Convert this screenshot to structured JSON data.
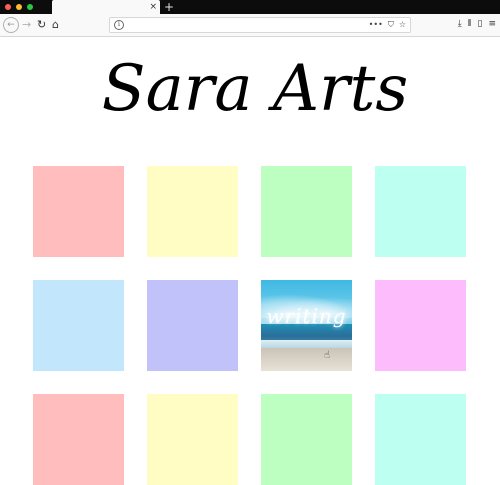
{
  "browser": {
    "traffic_lights": [
      {
        "name": "close",
        "color": "#ff5f57"
      },
      {
        "name": "minimize",
        "color": "#febc2e"
      },
      {
        "name": "maximize",
        "color": "#28c840"
      }
    ],
    "tab": {
      "title": "",
      "close_glyph": "×"
    },
    "new_tab_glyph": "+",
    "toolbar": {
      "back_glyph": "←",
      "forward_glyph": "→",
      "reload_glyph": "↻",
      "home_glyph": "⌂",
      "url": "",
      "info_glyph": "i",
      "url_actions": [
        {
          "name": "more-icon",
          "glyph": "•••"
        },
        {
          "name": "pocket-icon",
          "glyph": "⛉"
        },
        {
          "name": "bookmark-star-icon",
          "glyph": "☆"
        }
      ],
      "right_actions": [
        {
          "name": "downloads-icon",
          "glyph": "⤓"
        },
        {
          "name": "library-icon",
          "glyph": "⫴"
        },
        {
          "name": "sidebar-icon",
          "glyph": "▯"
        },
        {
          "name": "menu-icon",
          "glyph": "≡"
        }
      ]
    }
  },
  "page": {
    "title": "Sara Arts",
    "gallery": [
      {
        "kind": "swatch",
        "color": "#ffbdbd"
      },
      {
        "kind": "swatch",
        "color": "#fffcc4"
      },
      {
        "kind": "swatch",
        "color": "#bdffc0"
      },
      {
        "kind": "swatch",
        "color": "#bdfff0"
      },
      {
        "kind": "swatch",
        "color": "#c2e6fb"
      },
      {
        "kind": "swatch",
        "color": "#c2c2fb"
      },
      {
        "kind": "image",
        "label": "writing",
        "color": "#5bbfe0"
      },
      {
        "kind": "swatch",
        "color": "#fdbdfd"
      },
      {
        "kind": "swatch",
        "color": "#ffbdbd"
      },
      {
        "kind": "swatch",
        "color": "#fffcc4"
      },
      {
        "kind": "swatch",
        "color": "#bdffc0"
      },
      {
        "kind": "swatch",
        "color": "#bdfff0"
      }
    ]
  }
}
